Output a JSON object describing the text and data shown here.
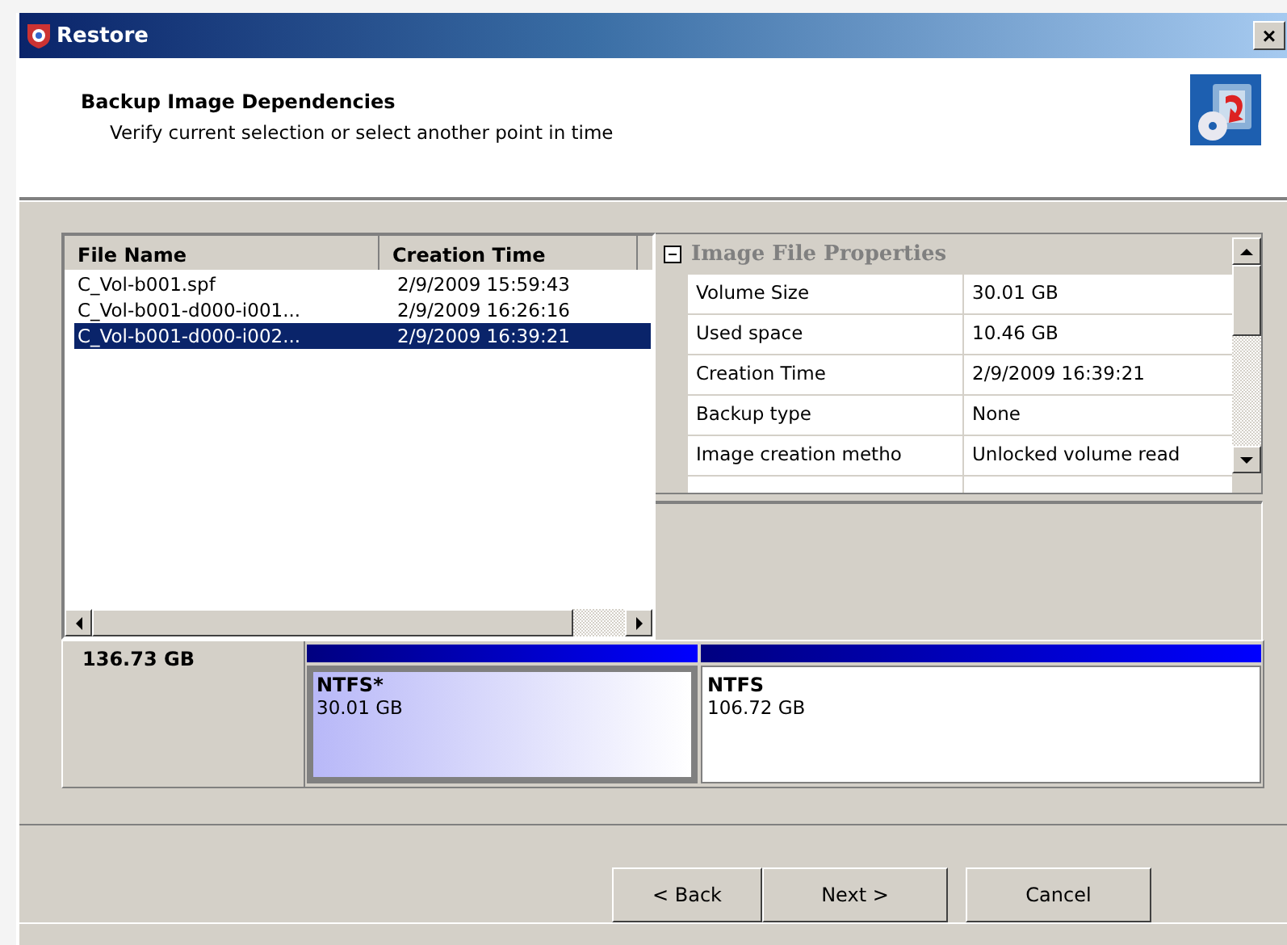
{
  "window": {
    "title": "Restore",
    "close": "×"
  },
  "header": {
    "title": "Backup Image Dependencies",
    "subtitle": "Verify current selection or select another point in time"
  },
  "file_list": {
    "columns": [
      "File Name",
      "Creation Time"
    ],
    "rows": [
      {
        "cells": [
          "C_Vol-b001.spf",
          "2/9/2009 15:59:43"
        ],
        "selected": false
      },
      {
        "cells": [
          "C_Vol-b001-d000-i001...",
          "2/9/2009 16:26:16"
        ],
        "selected": false
      },
      {
        "cells": [
          "C_Vol-b001-d000-i002...",
          "2/9/2009 16:39:21"
        ],
        "selected": true
      }
    ]
  },
  "properties": {
    "title": "Image File Properties",
    "rows": [
      {
        "name": "Volume Size",
        "value": "30.01 GB"
      },
      {
        "name": "Used space",
        "value": "10.46 GB"
      },
      {
        "name": "Creation Time",
        "value": "2/9/2009 16:39:21"
      },
      {
        "name": "Backup type",
        "value": "None"
      },
      {
        "name": "Image creation metho",
        "value": "Unlocked volume read"
      }
    ]
  },
  "disk": {
    "total": "136.73 GB",
    "partitions": [
      {
        "label": "NTFS*",
        "size": "30.01 GB",
        "selected": true
      },
      {
        "label": "NTFS",
        "size": "106.72 GB",
        "selected": false
      }
    ]
  },
  "buttons": [
    {
      "label": "< Back"
    },
    {
      "label": "Next >"
    },
    {
      "label": "Cancel"
    }
  ]
}
